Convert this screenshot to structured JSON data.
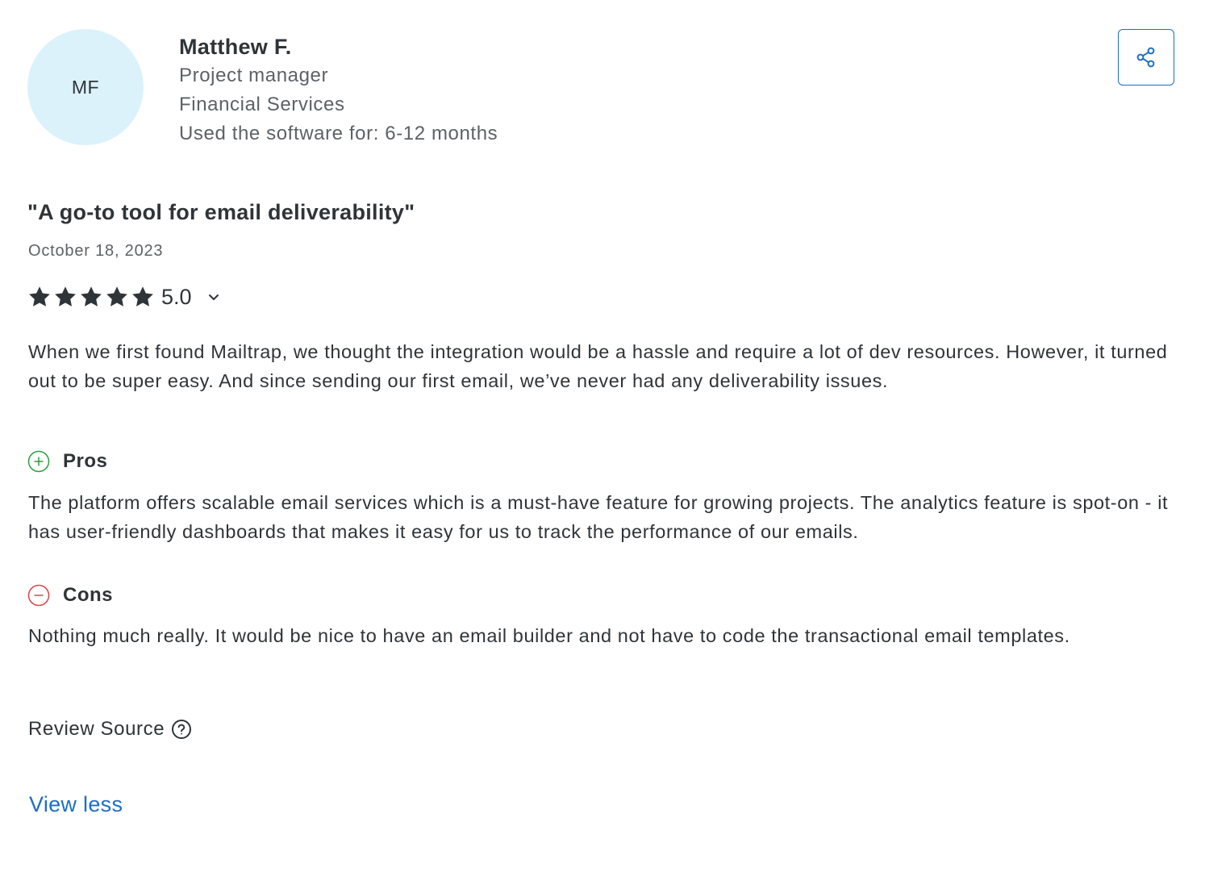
{
  "reviewer": {
    "initials": "MF",
    "name": "Matthew F.",
    "role": "Project manager",
    "industry": "Financial Services",
    "usage": "Used the software for: 6-12 months"
  },
  "review": {
    "title": "\"A go-to tool for email deliverability\"",
    "date": "October 18, 2023",
    "rating": "5.0",
    "star_count": 5,
    "summary": "When we first found Mailtrap, we thought the integration would be a hassle and require a lot of dev resources. However, it turned out to be super easy. And since sending our first email, we’ve never had any deliverability issues.",
    "pros_label": "Pros",
    "pros_text": "The platform offers scalable email services which is a must-have feature for growing projects. The analytics feature is spot-on - it has user-friendly dashboards that makes it easy for us to track the performance of our emails.",
    "cons_label": "Cons",
    "cons_text": "Nothing much really. It would be nice to have an email builder and not have to code the transactional email templates.",
    "source_label": "Review Source"
  },
  "actions": {
    "view_less": "View less"
  },
  "icons": {
    "share": "share-icon",
    "star": "star-icon",
    "chevron": "chevron-down-icon",
    "pros": "plus-circle-icon",
    "cons": "minus-circle-icon",
    "help": "question-circle-icon"
  },
  "colors": {
    "link": "#1d6ec4",
    "avatar_bg": "#dbf2fb",
    "pros": "#2e9e3f",
    "cons": "#e0424b",
    "text": "#2f3438",
    "muted": "#5c6266"
  }
}
